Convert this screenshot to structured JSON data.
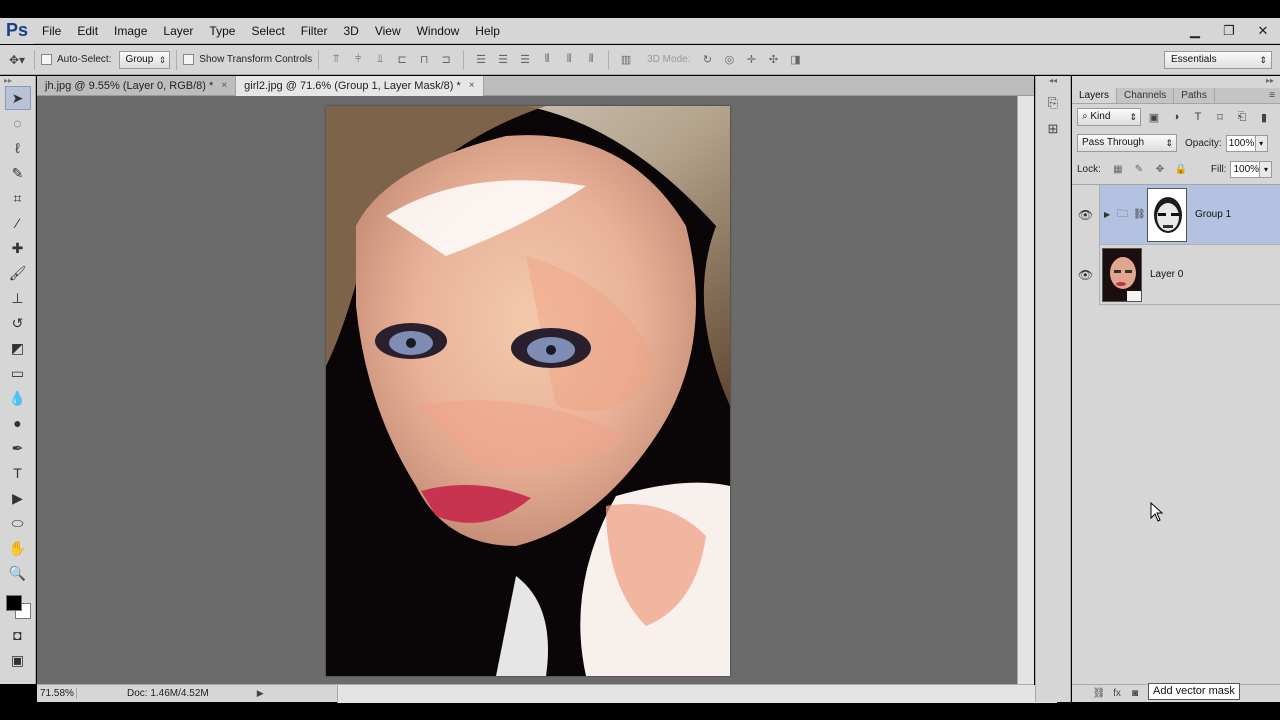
{
  "app": {
    "logo": "Ps"
  },
  "menu": [
    "File",
    "Edit",
    "Image",
    "Layer",
    "Type",
    "Select",
    "Filter",
    "3D",
    "View",
    "Window",
    "Help"
  ],
  "window_controls": {
    "minimize": "▁",
    "restore": "❐",
    "close": "✕"
  },
  "options_bar": {
    "auto_select_label": "Auto-Select:",
    "auto_select_value": "Group",
    "show_transform_label": "Show Transform Controls",
    "mode_3d_label": "3D Mode:",
    "workspace": "Essentials"
  },
  "tabs": [
    {
      "label": "jh.jpg @ 9.55% (Layer 0, RGB/8) *",
      "close": "×"
    },
    {
      "label": "girl2.jpg @ 71.6% (Group 1, Layer Mask/8) *",
      "close": "×"
    }
  ],
  "status": {
    "zoom": "71.58%",
    "doc": "Doc: 1.46M/4.52M"
  },
  "layers_panel": {
    "tabs": [
      "Layers",
      "Channels",
      "Paths"
    ],
    "kind_filter": "Kind",
    "blend_mode": "Pass Through",
    "opacity_label": "Opacity:",
    "opacity": "100%",
    "lock_label": "Lock:",
    "fill_label": "Fill:",
    "fill": "100%",
    "layers": [
      {
        "name": "Group 1",
        "selected": true
      },
      {
        "name": "Layer 0",
        "selected": false
      }
    ]
  },
  "tooltip": "Add vector mask",
  "colors": {
    "selection": "#b3c2e0",
    "accent": "#31a8ff"
  }
}
